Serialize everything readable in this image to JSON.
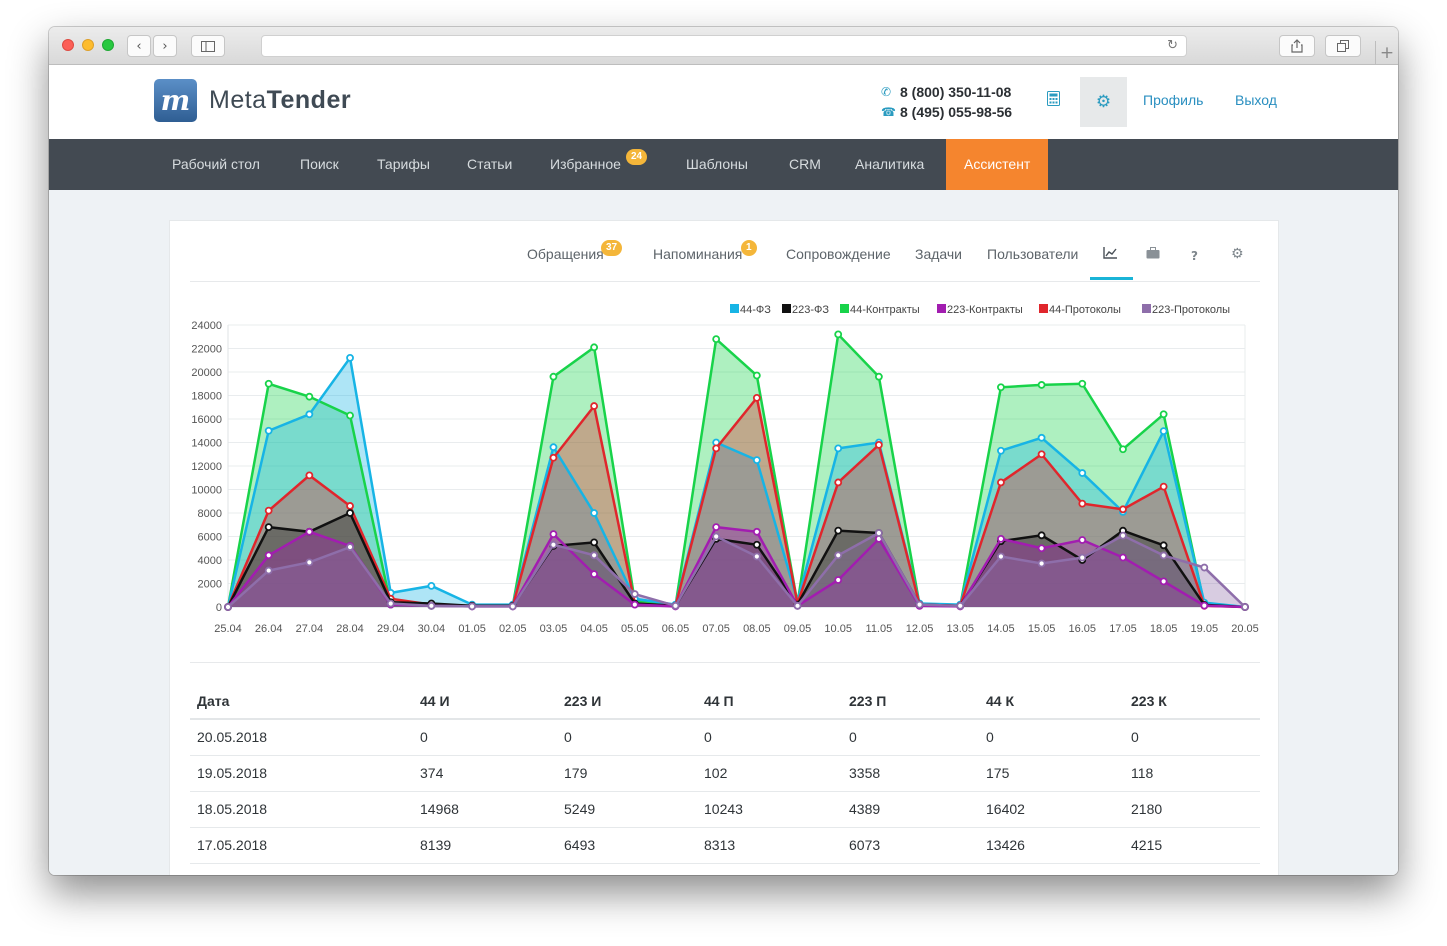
{
  "browser": {
    "back_icon": "chevron-left",
    "forward_icon": "chevron-right",
    "sidebar_icon": "sidebar",
    "reload_icon": "reload",
    "share_icon": "share",
    "tabs_icon": "tabs",
    "new_tab_icon": "plus"
  },
  "header": {
    "logo_letter": "m",
    "logo_text_light": "Meta",
    "logo_text_bold": "Tender",
    "phone1": "8 (800) 350-11-08",
    "phone2": "8 (495) 055-98-56",
    "profile_label": "Профиль",
    "logout_label": "Выход"
  },
  "nav": {
    "items": [
      "Рабочий стол",
      "Поиск",
      "Тарифы",
      "Статьи",
      "Избранное",
      "Шаблоны",
      "CRM",
      "Аналитика",
      "Ассистент"
    ],
    "favorites_badge": "24",
    "active": "Ассистент"
  },
  "subtabs": {
    "items": [
      "Обращения",
      "Напоминания",
      "Сопровождение",
      "Задачи",
      "Пользователи"
    ],
    "requests_badge": "37",
    "reminders_badge": "1",
    "icon_tabs": [
      "chart-icon",
      "briefcase-icon",
      "help-icon",
      "gear-icon"
    ],
    "help_glyph": "?",
    "active": "chart-icon"
  },
  "colors": {
    "accent": "#f5852e",
    "navbar": "#434a52",
    "link": "#2a8fc0",
    "badge": "#f4b63a"
  },
  "chart_data": {
    "type": "area",
    "x": [
      "25.04",
      "26.04",
      "27.04",
      "28.04",
      "29.04",
      "30.04",
      "01.05",
      "02.05",
      "03.05",
      "04.05",
      "05.05",
      "06.05",
      "07.05",
      "08.05",
      "09.05",
      "10.05",
      "11.05",
      "12.05",
      "13.05",
      "14.05",
      "15.05",
      "16.05",
      "17.05",
      "18.05",
      "19.05",
      "20.05"
    ],
    "ylim": [
      0,
      24000
    ],
    "yticks": [
      0,
      2000,
      4000,
      6000,
      8000,
      10000,
      12000,
      14000,
      16000,
      18000,
      20000,
      22000,
      24000
    ],
    "legend_position": "top-right",
    "grid": true,
    "series": [
      {
        "name": "44-ФЗ",
        "color": "#17b4e5",
        "values": [
          0,
          15000,
          16400,
          21200,
          1200,
          1800,
          200,
          200,
          13600,
          8000,
          700,
          200,
          14000,
          12500,
          500,
          13500,
          14000,
          300,
          200,
          13300,
          14400,
          11400,
          8100,
          14968,
          374,
          0
        ]
      },
      {
        "name": "223-ФЗ",
        "color": "#111111",
        "values": [
          0,
          6800,
          6400,
          8000,
          400,
          300,
          100,
          100,
          5200,
          5500,
          300,
          100,
          5800,
          5300,
          200,
          6500,
          6300,
          200,
          100,
          5600,
          6100,
          4000,
          6493,
          5249,
          179,
          0
        ]
      },
      {
        "name": "44-Контракты",
        "color": "#18d34a",
        "values": [
          0,
          19000,
          17900,
          16300,
          200,
          100,
          100,
          100,
          19600,
          22100,
          500,
          100,
          22800,
          19700,
          300,
          23200,
          19600,
          200,
          100,
          18700,
          18900,
          19000,
          13426,
          16402,
          175,
          0
        ]
      },
      {
        "name": "223-Контракты",
        "color": "#a21db0",
        "values": [
          0,
          4400,
          6400,
          5200,
          200,
          100,
          50,
          50,
          6200,
          2800,
          200,
          50,
          6800,
          6400,
          100,
          2300,
          5800,
          100,
          50,
          5800,
          5000,
          5700,
          4215,
          2180,
          118,
          0
        ]
      },
      {
        "name": "44-Протоколы",
        "color": "#e0262c",
        "values": [
          0,
          8200,
          11200,
          8600,
          700,
          200,
          100,
          100,
          12700,
          17100,
          300,
          100,
          13500,
          17800,
          300,
          10600,
          13800,
          200,
          100,
          10600,
          13000,
          8800,
          8313,
          10243,
          102,
          0
        ]
      },
      {
        "name": "223-Протоколы",
        "color": "#8e6eaa",
        "values": [
          0,
          3100,
          3800,
          5100,
          300,
          100,
          50,
          50,
          5300,
          4400,
          1100,
          100,
          6000,
          4300,
          100,
          4400,
          6300,
          200,
          100,
          4300,
          3700,
          4200,
          6073,
          4389,
          3358,
          0
        ]
      }
    ]
  },
  "table": {
    "columns": [
      "Дата",
      "44 И",
      "223 И",
      "44 П",
      "223 П",
      "44 К",
      "223 К"
    ],
    "rows": [
      [
        "20.05.2018",
        "0",
        "0",
        "0",
        "0",
        "0",
        "0"
      ],
      [
        "19.05.2018",
        "374",
        "179",
        "102",
        "3358",
        "175",
        "118"
      ],
      [
        "18.05.2018",
        "14968",
        "5249",
        "10243",
        "4389",
        "16402",
        "2180"
      ],
      [
        "17.05.2018",
        "8139",
        "6493",
        "8313",
        "6073",
        "13426",
        "4215"
      ]
    ]
  }
}
